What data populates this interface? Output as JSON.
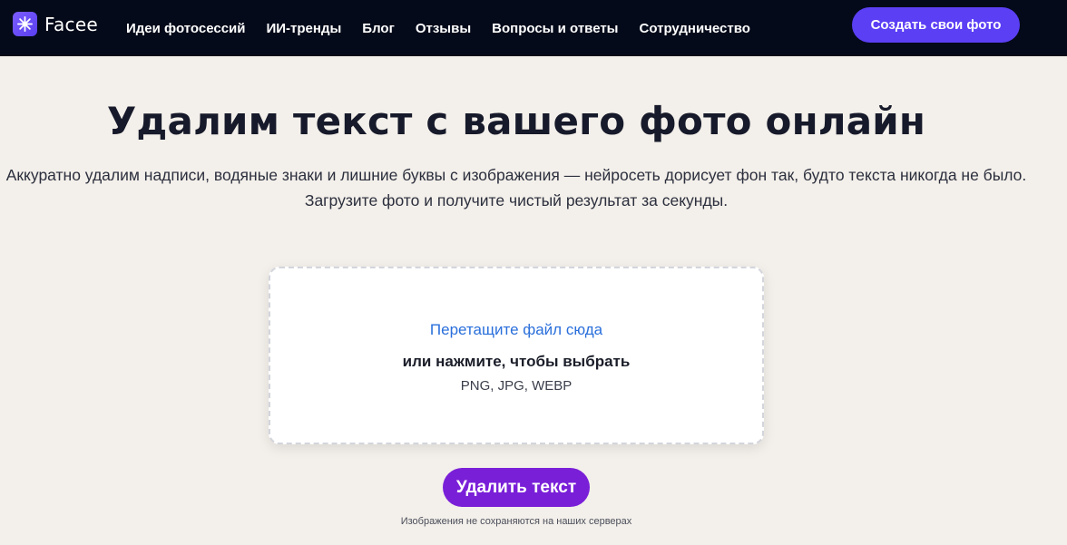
{
  "header": {
    "brand": "Facee",
    "nav": [
      "Идеи фотосессий",
      "ИИ-тренды",
      "Блог",
      "Отзывы",
      "Вопросы и ответы",
      "Сотрудничество"
    ],
    "cta_label": "Создать свои фото"
  },
  "hero": {
    "title": "Удалим текст с вашего фото онлайн",
    "subtitle_line1": "Аккуратно удалим надписи, водяные знаки и лишние буквы с изображения — нейросеть дорисует фон так, будто текста никогда не было.",
    "subtitle_line2": "Загрузите фото и получите чистый результат за секунды."
  },
  "upload": {
    "primary": "Перетащите файл сюда",
    "secondary": "или нажмите, чтобы выбрать",
    "formats": "PNG, JPG, WEBP"
  },
  "action": {
    "button_label": "Удалить текст",
    "privacy_note": "Изображения не сохраняются на наших серверах"
  },
  "colors": {
    "topbar_bg": "#040a1a",
    "page_bg": "#f3efea",
    "cta_bg": "#5b3ff4",
    "action_bg": "#7a1fd8",
    "link_blue": "#2a6fdb"
  },
  "icons": {
    "logo": "sparkle-logo-icon"
  }
}
